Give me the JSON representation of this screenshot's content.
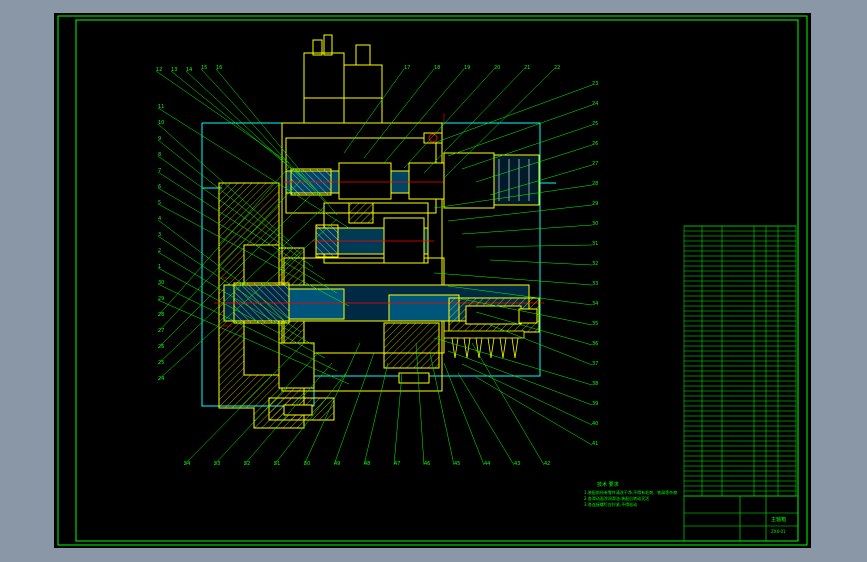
{
  "balloons_left": [
    "12",
    "13",
    "14",
    "15",
    "16",
    "11",
    "10",
    "9",
    "8",
    "7",
    "6",
    "5",
    "4",
    "3",
    "2",
    "1",
    "30",
    "29",
    "28",
    "27",
    "26",
    "25",
    "24"
  ],
  "balloons_top": [
    "17",
    "18",
    "19",
    "20",
    "21",
    "22"
  ],
  "balloons_right": [
    "23",
    "24",
    "25",
    "26",
    "27",
    "28",
    "29",
    "30",
    "31",
    "32",
    "33",
    "34",
    "35",
    "36",
    "37",
    "38",
    "39",
    "40",
    "41"
  ],
  "balloons_bottom": [
    "54",
    "53",
    "52",
    "51",
    "50",
    "49",
    "48",
    "47",
    "46",
    "45",
    "44",
    "43",
    "42"
  ],
  "tech_notes": {
    "title": "技术 要求",
    "lines": [
      "1.装配前所有零件清洗干净,不得有毛刺、铁屑等杂物",
      "2.各滑动面涂润滑油,装配后转动灵活",
      "3.各连接螺钉应拧紧,不得松动"
    ]
  },
  "title_block": {
    "title": "主轴箱",
    "drawing_no": "ZXX-01"
  },
  "colors": {
    "background": "#000000",
    "frame": "#00ff00",
    "outline": "#ffff00",
    "housing": "#00ffff",
    "leader": "#00ff00",
    "dimension": "#ff0000",
    "shaft_fill": "#00aaff"
  }
}
